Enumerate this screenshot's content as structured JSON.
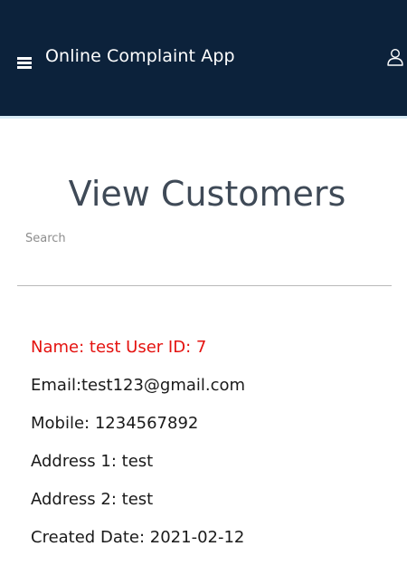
{
  "header": {
    "app_title": "Online Complaint App",
    "menu_icon": "hamburger-menu-icon",
    "user_icon": "user-profile-icon",
    "background_color": "#0c223b"
  },
  "main": {
    "page_title": "View Customers",
    "search": {
      "label": "Search",
      "value": "",
      "placeholder": ""
    }
  },
  "customer": {
    "name_line": "Name: test User ID: 7",
    "email_line": "Email:test123@gmail.com",
    "mobile_line": "Mobile: 1234567892",
    "address1_line": "Address 1: test",
    "address2_line": "Address 2: test",
    "created_line": "Created Date: 2021-02-12",
    "highlight_color": "#e4120f"
  }
}
